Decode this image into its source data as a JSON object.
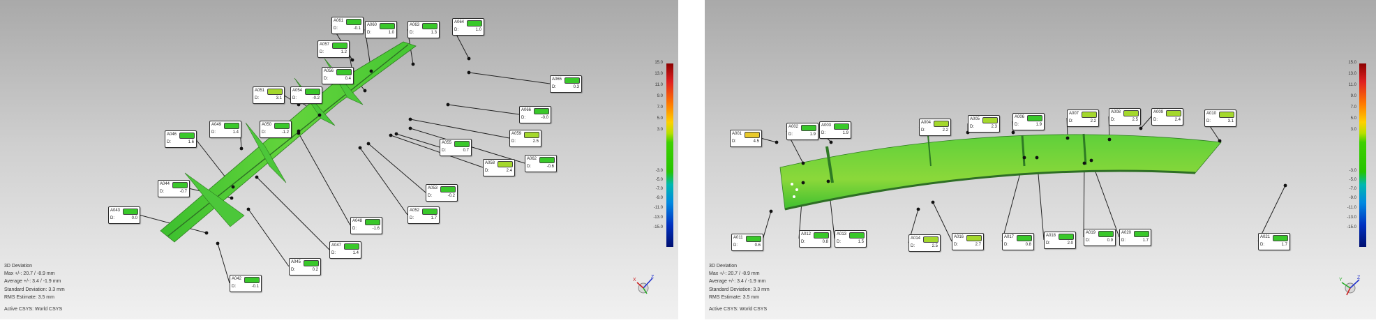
{
  "colors": {
    "green": "#39c82a",
    "light_green": "#a4d82c",
    "yellow": "#e8c92a",
    "part_green": "#46c63a"
  },
  "left_view": {
    "callouts": [
      {
        "id": "A061",
        "d": "-0.1",
        "color": "green"
      },
      {
        "id": "A060",
        "d": "1.0",
        "color": "green"
      },
      {
        "id": "A063",
        "d": "1.3",
        "color": "green"
      },
      {
        "id": "A064",
        "d": "1.0",
        "color": "green"
      },
      {
        "id": "A057",
        "d": "1.2",
        "color": "green"
      },
      {
        "id": "A065",
        "d": "0.3",
        "color": "green"
      },
      {
        "id": "A056",
        "d": "0.4",
        "color": "green"
      },
      {
        "id": "A051",
        "d": "3.1",
        "color": "light_green"
      },
      {
        "id": "A054",
        "d": "-0.2",
        "color": "green"
      },
      {
        "id": "A066",
        "d": "-0.0",
        "color": "green"
      },
      {
        "id": "A049",
        "d": "1.4",
        "color": "green"
      },
      {
        "id": "A050",
        "d": "-1.2",
        "color": "green"
      },
      {
        "id": "A059",
        "d": "2.5",
        "color": "light_green"
      },
      {
        "id": "A046",
        "d": "1.6",
        "color": "green"
      },
      {
        "id": "A062",
        "d": "-0.6",
        "color": "green"
      },
      {
        "id": "A058",
        "d": "2.4",
        "color": "light_green"
      },
      {
        "id": "A055",
        "d": "0.7",
        "color": "green"
      },
      {
        "id": "A044",
        "d": "-0.7",
        "color": "green"
      },
      {
        "id": "A053",
        "d": "-0.2",
        "color": "green"
      },
      {
        "id": "A043",
        "d": "0.0",
        "color": "green"
      },
      {
        "id": "A052",
        "d": "1.7",
        "color": "green"
      },
      {
        "id": "A048",
        "d": "-1.6",
        "color": "green"
      },
      {
        "id": "A047",
        "d": "1.4",
        "color": "green"
      },
      {
        "id": "A045",
        "d": "0.2",
        "color": "green"
      },
      {
        "id": "A042",
        "d": "-0.1",
        "color": "green"
      }
    ],
    "stats": {
      "title": "3D Deviation",
      "max": "Max +/-: 20.7 / -8.9 mm",
      "average": "Average +/-: 3.4 / -1.9 mm",
      "std_dev": "Standard Deviation: 3.3 mm",
      "rms": "RMS Estimate: 3.5 mm",
      "csys": "Active CSYS: World CSYS"
    }
  },
  "right_view": {
    "callouts": [
      {
        "id": "A001",
        "d": "4.5",
        "color": "yellow"
      },
      {
        "id": "A002",
        "d": "1.9",
        "color": "green"
      },
      {
        "id": "A003",
        "d": "1.9",
        "color": "green"
      },
      {
        "id": "A004",
        "d": "2.2",
        "color": "light_green"
      },
      {
        "id": "A005",
        "d": "2.3",
        "color": "light_green"
      },
      {
        "id": "A006",
        "d": "1.9",
        "color": "green"
      },
      {
        "id": "A007",
        "d": "2.2",
        "color": "light_green"
      },
      {
        "id": "A008",
        "d": "2.5",
        "color": "light_green"
      },
      {
        "id": "A009",
        "d": "2.4",
        "color": "light_green"
      },
      {
        "id": "A010",
        "d": "3.1",
        "color": "light_green"
      },
      {
        "id": "A011",
        "d": "0.6",
        "color": "green"
      },
      {
        "id": "A012",
        "d": "0.8",
        "color": "green"
      },
      {
        "id": "A013",
        "d": "1.5",
        "color": "green"
      },
      {
        "id": "A014",
        "d": "2.5",
        "color": "light_green"
      },
      {
        "id": "A016",
        "d": "2.7",
        "color": "light_green"
      },
      {
        "id": "A017",
        "d": "0.8",
        "color": "green"
      },
      {
        "id": "A018",
        "d": "2.0",
        "color": "green"
      },
      {
        "id": "A019",
        "d": "0.9",
        "color": "green"
      },
      {
        "id": "A020",
        "d": "1.7",
        "color": "green"
      },
      {
        "id": "A021",
        "d": "1.7",
        "color": "green"
      }
    ],
    "stats": {
      "title": "3D Deviation",
      "max": "Max +/-: 20.7 / -8.9 mm",
      "average": "Average +/-: 3.4 / -1.9 mm",
      "std_dev": "Standard Deviation: 3.3 mm",
      "rms": "RMS Estimate: 3.5 mm",
      "csys": "Active CSYS: World CSYS"
    }
  },
  "callout_d_label": "D:",
  "color_scale": {
    "upper_ticks": [
      "15.0",
      "13.0",
      "11.0",
      "9.0",
      "7.0",
      "5.0",
      "3.0"
    ],
    "lower_ticks": [
      "-3.0",
      "-5.0",
      "-7.0",
      "-9.0",
      "-11.0",
      "-13.0",
      "-15.0"
    ]
  },
  "axis_icon": {
    "labels": [
      "Y",
      "X",
      "Z"
    ]
  }
}
